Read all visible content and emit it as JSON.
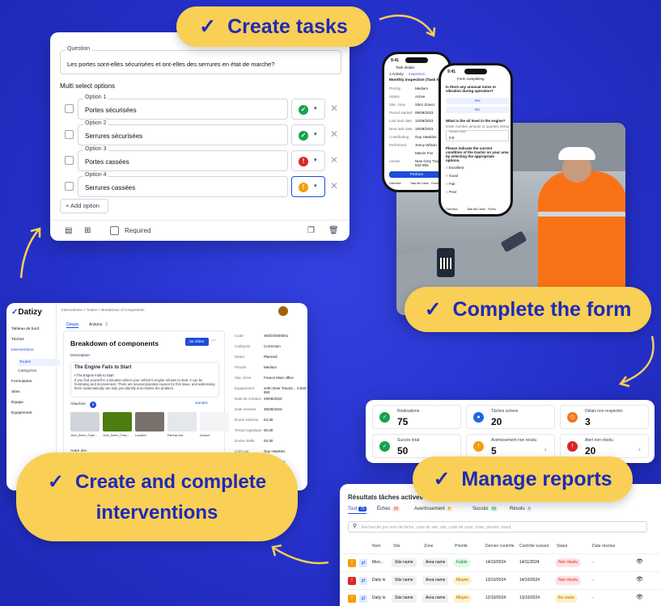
{
  "pills": {
    "create_tasks": "Create tasks",
    "complete_form": "Complete the form",
    "create_interventions_1": "Create and complete",
    "create_interventions_2": "interventions",
    "manage_reports": "Manage reports",
    "check": "✓"
  },
  "form": {
    "question_label": "Question",
    "question_text": "Les portes sont-elles sécurisées et ont-elles des serrures en état de marche?",
    "multi_select": "Multi select options",
    "options": [
      {
        "label": "Option 1",
        "value": "Portes sécurisées",
        "icon": "✓",
        "color": "#16a34a"
      },
      {
        "label": "Option 2",
        "value": "Serrures sécurisées",
        "icon": "✓",
        "color": "#16a34a"
      },
      {
        "label": "Option 3",
        "value": "Portes cassées",
        "icon": "!",
        "color": "#dc2626"
      },
      {
        "label": "Option 4",
        "value": "Serrures cassées",
        "icon": "!",
        "color": "#f59e0b"
      }
    ],
    "add_option": "+ Add option",
    "required": "Required"
  },
  "phone1": {
    "time": "9:41",
    "title": "Task details",
    "breadcrumb": "1 Activity",
    "badge": "Inspection",
    "heading": "Monthly inspection (Task Name)",
    "fields": [
      {
        "k": "Priority",
        "v": "Medium"
      },
      {
        "k": "Status",
        "v": "Active"
      },
      {
        "k": "Site, zone",
        "v": "Site1 Zone1"
      },
      {
        "k": "Period started",
        "v": "09/09/2023"
      },
      {
        "k": "Last task date",
        "v": "12/09/2023"
      },
      {
        "k": "Next task date",
        "v": "15/09/2023"
      },
      {
        "k": "Contributing",
        "v": "Guy Hawkins"
      },
      {
        "k": "Performed",
        "v": "Jenny Wilson"
      },
      {
        "k": "",
        "v": "Marvin Fox"
      },
      {
        "k": "Assets",
        "v": "New Grey Tractor 4-532-993"
      }
    ],
    "button": "Perform",
    "tabs": [
      "Overview",
      "Task list Cards",
      "Forms"
    ]
  },
  "phone2": {
    "time": "9:41",
    "title": "Form completing",
    "q1": "Is there any unusual noise or vibration during operation?",
    "yes": "Yes",
    "no": "No",
    "q2": "What is the oil level in the engine?",
    "q2_hint": "Enter number amount or quantity below",
    "q2_label": "Number input",
    "q2_value": "0.8",
    "q3": "Please indicate the current condition of the tractor on your area by selecting the appropriate options.",
    "choices": [
      "Excellent",
      "Good",
      "Fair",
      "Poor"
    ],
    "tabs": [
      "Overview",
      "Task list Cards",
      "Forms"
    ]
  },
  "dash": {
    "logo": "Datizy",
    "breadcrumb": "Interventions > Toutes > Breakdown of components",
    "nav": [
      {
        "label": "Tableau de bord"
      },
      {
        "label": "Tâches"
      },
      {
        "label": "Interventions",
        "active": true
      },
      {
        "label": "Toutes",
        "sub": true,
        "active": true
      },
      {
        "label": "Catégories",
        "sub": true
      },
      {
        "label": "Formulaires"
      },
      {
        "label": "Sites"
      },
      {
        "label": "Équipe"
      },
      {
        "label": "Équipement"
      }
    ],
    "tabs": [
      "Détails",
      "Actions"
    ],
    "actions_count": "3",
    "title": "Breakdown of components",
    "button": "Se rétirer",
    "desc_label": "Description",
    "desc_title": "The Engine Fails to Start",
    "desc_bullet": "• The Engine Fails to Start",
    "desc_text": "If you find yourself in a situation where your vehicle's engine refuses to start, it can be frustrating and inconvenient. There are several potential causes for this issue, and addressing them systematically can help you identify and resolve the problem.",
    "attach_label": "Attaches",
    "attach_count": "6",
    "attach_btn": "Joindre",
    "thumbs": [
      "Jhon_Deere_Tract...",
      "John_Deere_Tract...",
      "Location",
      "PartList.xlsx",
      "Documi"
    ],
    "other": "Autre doc",
    "details": [
      {
        "k": "Code",
        "v": "SE/DO/000001"
      },
      {
        "k": "Catégorie",
        "v": "Correction"
      },
      {
        "k": "Statut",
        "v": "Planned"
      },
      {
        "k": "Priorité",
        "v": "Medium"
      },
      {
        "k": "Site, Zone",
        "v": "France  Main office"
      },
      {
        "k": "Équipement",
        "v": "John Deer Tractor... 4-532-993"
      },
      {
        "k": "Date de création",
        "v": "29/09/2024"
      },
      {
        "k": "Date estimée",
        "v": "30/09/2024"
      },
      {
        "k": "Durée estimée",
        "v": "04:30"
      },
      {
        "k": "Temps logistique",
        "v": "00:30"
      },
      {
        "k": "Durée réelle",
        "v": "04:30"
      },
      {
        "k": "Créé par",
        "v": "Guy Hawkins"
      },
      {
        "k": "",
        "v": "Guy Hawkins"
      }
    ]
  },
  "stats": [
    {
      "label": "Réalisations",
      "value": "75",
      "color": "#16a34a",
      "icon": "✓"
    },
    {
      "label": "Tâches actives",
      "value": "20",
      "color": "#2563eb",
      "icon": "●"
    },
    {
      "label": "Délais non respectés",
      "value": "3",
      "color": "#f97316",
      "icon": "◷"
    },
    {
      "label": "Succès total",
      "value": "50",
      "color": "#16a34a",
      "icon": "✓"
    },
    {
      "label": "Avertissement non résolu",
      "value": "5",
      "color": "#f59e0b",
      "icon": "!",
      "badge": "2"
    },
    {
      "label": "Alert non résolu",
      "value": "20",
      "color": "#dc2626",
      "icon": "!",
      "badge": "3"
    }
  ],
  "table": {
    "title": "Résultats tâches actives",
    "tabs": [
      {
        "label": "Tout",
        "count": "75",
        "color": "#1d4ed8",
        "bg": "#1d4ed8",
        "fg": "#fff"
      },
      {
        "label": "Échec",
        "count": "20",
        "color": "#dc2626",
        "bg": "#fee2e2",
        "fg": "#dc2626"
      },
      {
        "label": "Avertissement",
        "count": "5",
        "color": "#f59e0b",
        "bg": "#fef3c7",
        "fg": "#b45309"
      },
      {
        "label": "Succès",
        "count": "50",
        "color": "#16a34a",
        "bg": "#dcfce7",
        "fg": "#15803d"
      },
      {
        "label": "Résolu",
        "count": "0",
        "color": "#6b7280",
        "bg": "#eef0f3",
        "fg": "#6b7280"
      }
    ],
    "search": "Recherche par nom de tâche, code de site, site, code de zone, zone, priorité, statut",
    "headers": [
      "Nom",
      "Site",
      "Zone",
      "Priorité",
      "Dernier contrôle",
      "Contrôle suivant",
      "Statut",
      "Date résolue"
    ],
    "rows": [
      {
        "sq": "#f59e0b",
        "sqi": "!",
        "name": "Mon...",
        "site": "Site name",
        "zone": "Area name",
        "prio": "Faible",
        "pbg": "#dcfce7",
        "pfg": "#15803d",
        "last": "14/10/2024",
        "next": "14/11/2024",
        "status": "Non résolu",
        "sbg": "#fee2e2",
        "sfg": "#dc2626",
        "date": "-"
      },
      {
        "sq": "#dc2626",
        "sqi": "!",
        "name": "Daily lo",
        "site": "Site name",
        "zone": "Area name",
        "prio": "Moyen",
        "pbg": "#fef3c7",
        "pfg": "#b45309",
        "last": "13/10/2024",
        "next": "14/10/2024",
        "status": "Non résolu",
        "sbg": "#fee2e2",
        "sfg": "#dc2626",
        "date": "-"
      },
      {
        "sq": "#f59e0b",
        "sqi": "!",
        "name": "Daily lo",
        "site": "Site name",
        "zone": "Area name",
        "prio": "Moyen",
        "pbg": "#fef3c7",
        "pfg": "#b45309",
        "last": "12/10/2024",
        "next": "13/10/2024",
        "status": "En cours",
        "sbg": "#fef3c7",
        "sfg": "#b45309",
        "date": "-"
      }
    ]
  }
}
